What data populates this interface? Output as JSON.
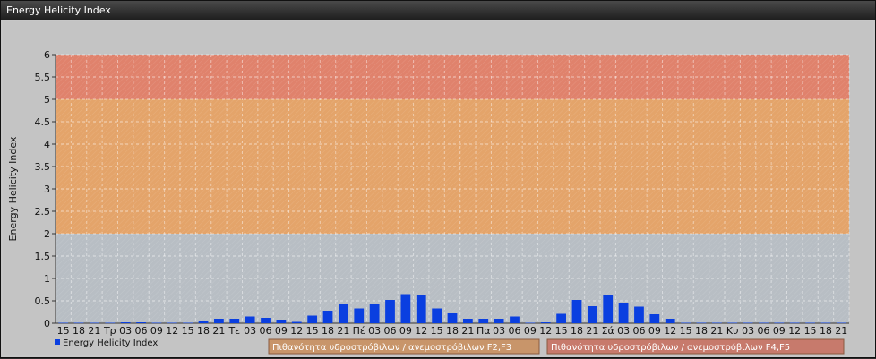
{
  "window": {
    "title": "Energy Helicity Index"
  },
  "chart_data": {
    "type": "bar",
    "title": "",
    "ylabel": "Energy Helicity Index",
    "ylim": [
      0,
      6
    ],
    "yticks": [
      "0",
      "0.5",
      "1",
      "1.5",
      "2",
      "2.5",
      "3",
      "3.5",
      "4",
      "4.5",
      "5",
      "5.5",
      "6"
    ],
    "categories": [
      "15",
      "18",
      "21",
      "Τρ",
      "03",
      "06",
      "09",
      "12",
      "15",
      "18",
      "21",
      "Τε",
      "03",
      "06",
      "09",
      "12",
      "15",
      "18",
      "21",
      "Πέ",
      "03",
      "06",
      "09",
      "12",
      "15",
      "18",
      "21",
      "Πα",
      "03",
      "06",
      "09",
      "12",
      "15",
      "18",
      "21",
      "Σά",
      "03",
      "06",
      "09",
      "12",
      "15",
      "18",
      "21",
      "Κυ",
      "03",
      "06",
      "09",
      "12",
      "15",
      "18",
      "21"
    ],
    "series": [
      {
        "name": "Energy Helicity Index",
        "color": "#0a3fe0",
        "values": [
          0.01,
          0.01,
          0.01,
          0.01,
          0.02,
          0.02,
          0.01,
          0.01,
          0.01,
          0.06,
          0.1,
          0.1,
          0.15,
          0.12,
          0.08,
          0.03,
          0.17,
          0.28,
          0.42,
          0.33,
          0.42,
          0.52,
          0.65,
          0.64,
          0.33,
          0.22,
          0.1,
          0.1,
          0.1,
          0.15,
          0.01,
          0.02,
          0.21,
          0.52,
          0.38,
          0.62,
          0.45,
          0.37,
          0.2,
          0.1,
          0.01,
          0.01,
          0.01,
          0.01,
          0.01,
          0.01,
          0.01,
          0.01,
          0.01,
          0.01,
          0.01
        ]
      }
    ],
    "bands": [
      {
        "from": 0,
        "to": 2,
        "color": "#b8bec4"
      },
      {
        "from": 2,
        "to": 5,
        "color": "#e4a46a"
      },
      {
        "from": 5,
        "to": 6,
        "color": "#e0826c"
      }
    ],
    "legend_position": "bottom-left",
    "grid": true
  },
  "band_legend": [
    {
      "label": "Πιθανότητα υδροστρόβιλων / ανεμοστρόβιλων F2,F3",
      "color": "#c8956a"
    },
    {
      "label": "Πιθανότητα υδροστρόβιλων / ανεμοστρόβιλων F4,F5",
      "color": "#c77a6c"
    }
  ]
}
